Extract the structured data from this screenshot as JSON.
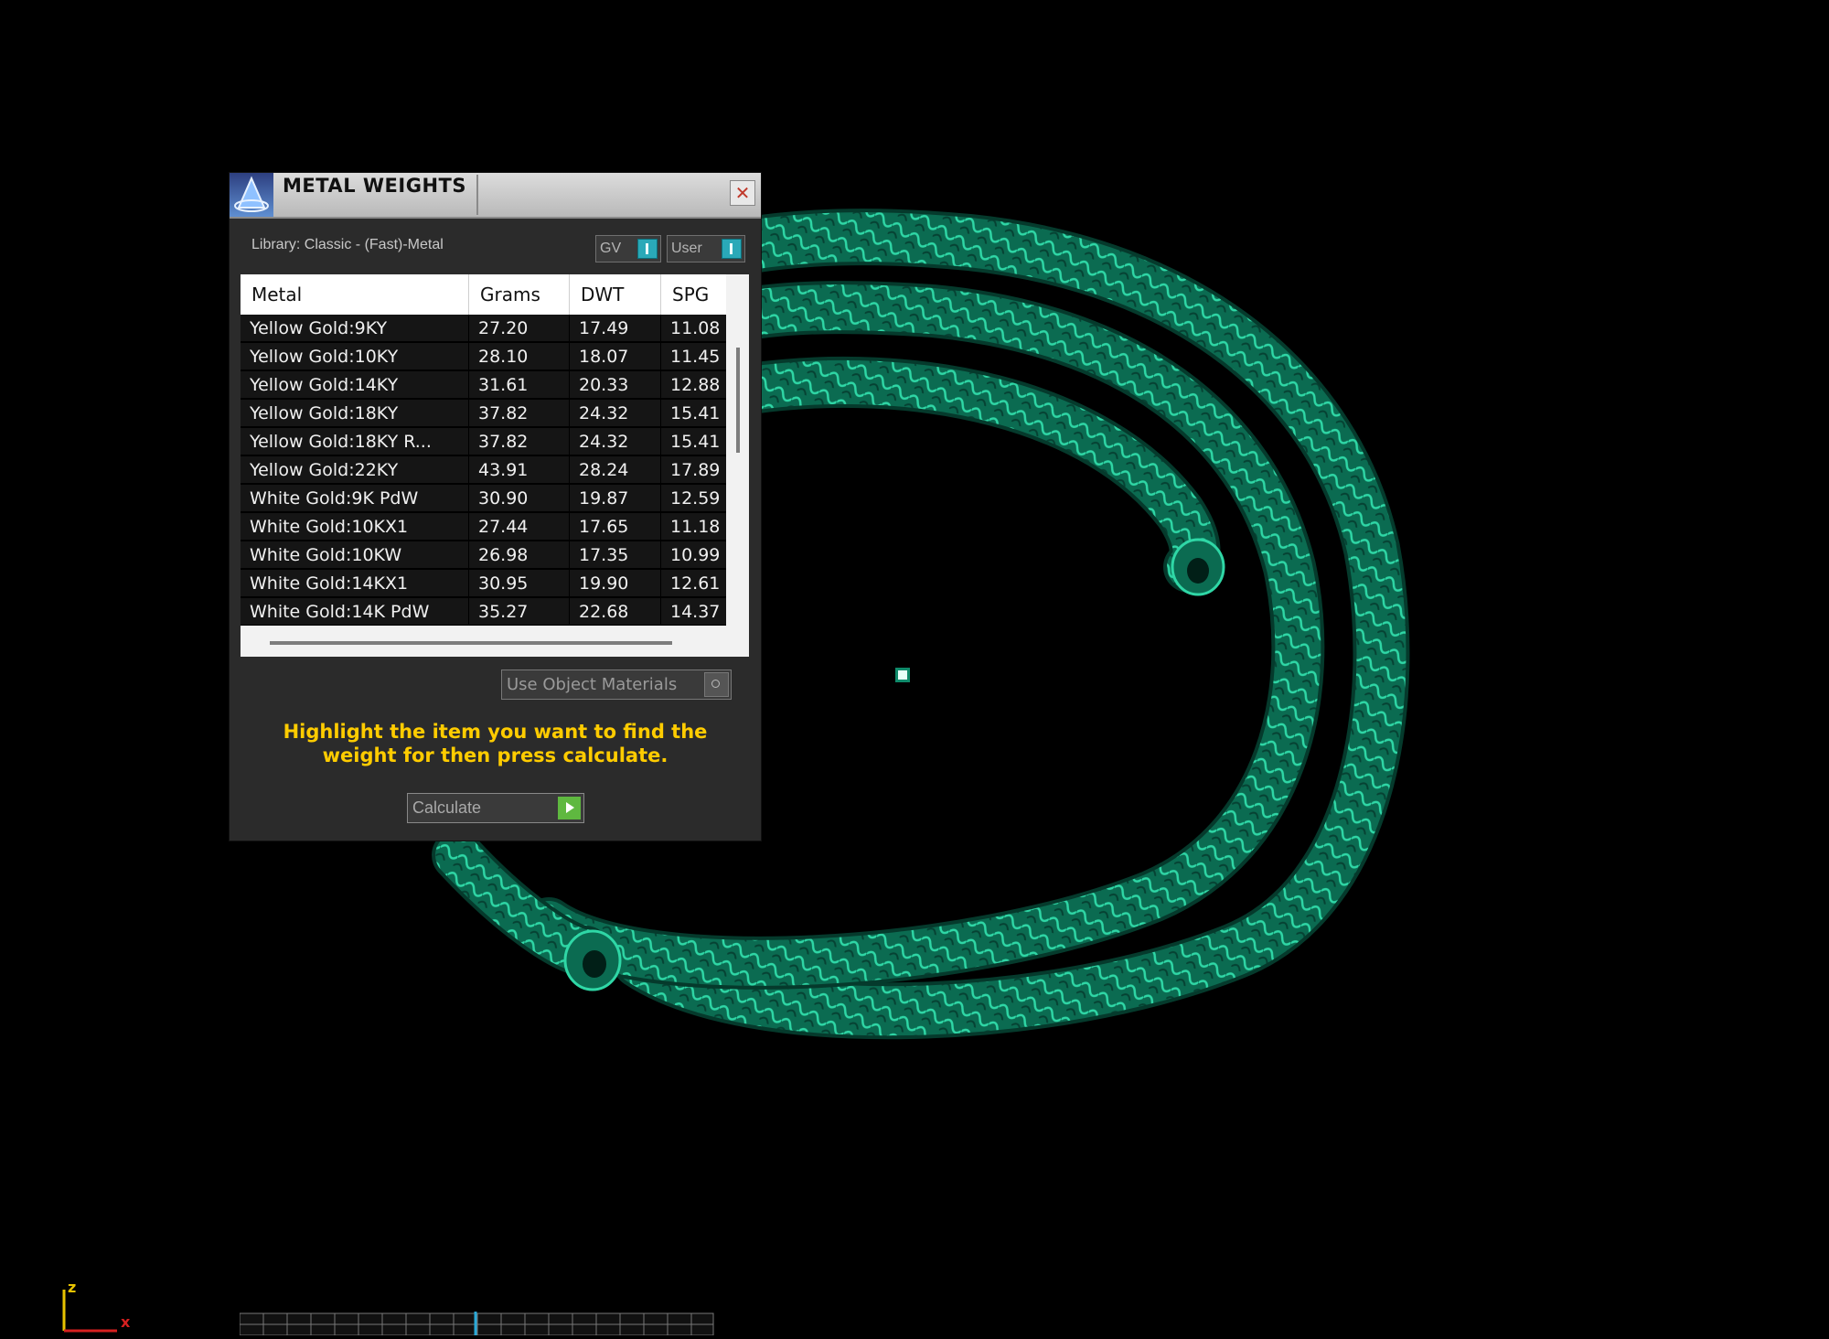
{
  "dialog": {
    "title": "METAL WEIGHTS",
    "close_label": "✕",
    "library_label": "Library: Classic - (Fast)-Metal",
    "toggles": {
      "gv": "GV",
      "user": "User"
    },
    "table": {
      "columns": [
        "Metal",
        "Grams",
        "DWT",
        "SPG"
      ],
      "rows": [
        [
          "Yellow Gold:9KY",
          "27.20",
          "17.49",
          "11.08"
        ],
        [
          "Yellow Gold:10KY",
          "28.10",
          "18.07",
          "11.45"
        ],
        [
          "Yellow Gold:14KY",
          "31.61",
          "20.33",
          "12.88"
        ],
        [
          "Yellow Gold:18KY",
          "37.82",
          "24.32",
          "15.41"
        ],
        [
          "Yellow Gold:18KY R...",
          "37.82",
          "24.32",
          "15.41"
        ],
        [
          "Yellow Gold:22KY",
          "43.91",
          "28.24",
          "17.89"
        ],
        [
          "White Gold:9K PdW",
          "30.90",
          "19.87",
          "12.59"
        ],
        [
          "White Gold:10KX1",
          "27.44",
          "17.65",
          "11.18"
        ],
        [
          "White Gold:10KW",
          "26.98",
          "17.35",
          "10.99"
        ],
        [
          "White Gold:14KX1",
          "30.95",
          "19.90",
          "12.61"
        ],
        [
          "White Gold:14K PdW",
          "35.27",
          "22.68",
          "14.37"
        ]
      ]
    },
    "use_object_materials_label": "Use Object Materials",
    "instructions": "Highlight the item you want to find the weight for then press calculate.",
    "calculate_label": "Calculate"
  },
  "viewport": {
    "axis": {
      "z": "z",
      "x": "x"
    },
    "colors": {
      "chain": "#0b7a5c",
      "highlight": "#2fd7a6",
      "accent": "#ffcc00"
    }
  }
}
